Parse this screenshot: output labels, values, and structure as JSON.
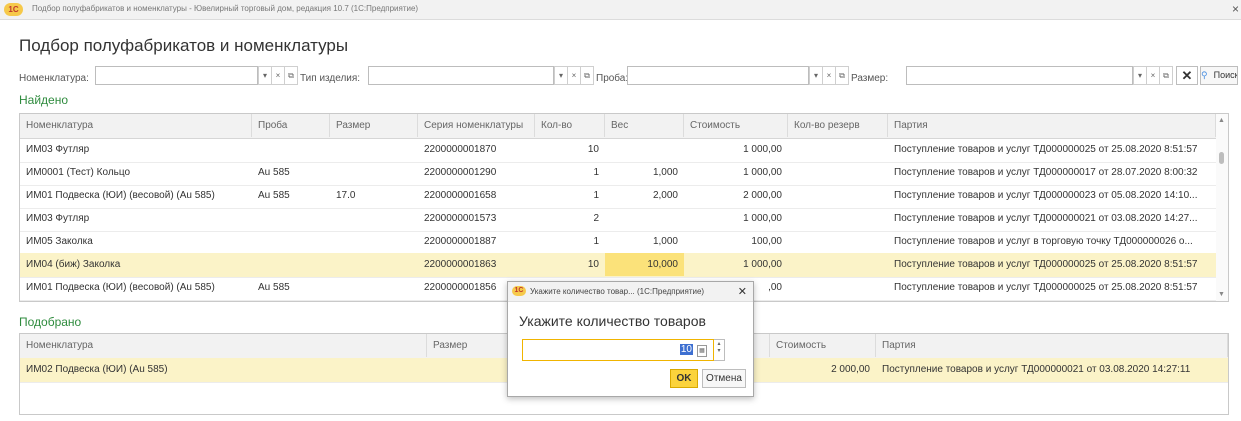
{
  "window": {
    "app_icon_text": "1C",
    "title": "Подбор полуфабрикатов и номенклатуры - Ювелирный торговый дом, редакция 10.7  (1С:Предприятие)",
    "close_glyph": "×"
  },
  "page": {
    "heading": "Подбор полуфабрикатов и номенклатуры"
  },
  "filters": {
    "nomenclature_label": "Номенклатура:",
    "product_type_label": "Тип изделия:",
    "assay_label": "Проба:",
    "size_label": "Размер:",
    "nomenclature_value": "",
    "product_type_value": "",
    "assay_value": "",
    "size_value": "",
    "search_label": "Поиск"
  },
  "found": {
    "title": "Найдено",
    "columns": [
      "Номенклатура",
      "Проба",
      "Размер",
      "Серия номенклатуры",
      "Кол-во",
      "Вес",
      "Стоимость",
      "Кол-во резерв",
      "Партия"
    ],
    "rows": [
      {
        "name": "ИМ03 Футляр",
        "assay": "",
        "size": "",
        "series": "2200000001870",
        "qty": "10",
        "weight": "",
        "cost": "1 000,00",
        "reserve": "",
        "batch": "Поступление товаров и услуг ТД000000025 от 25.08.2020 8:51:57"
      },
      {
        "name": "ИМ0001 (Тест) Кольцо",
        "assay": "Au 585",
        "size": "",
        "series": "2200000001290",
        "qty": "1",
        "weight": "1,000",
        "cost": "1 000,00",
        "reserve": "",
        "batch": "Поступление товаров и услуг ТД000000017 от 28.07.2020 8:00:32"
      },
      {
        "name": "ИМ01 Подвеска (ЮИ) (весовой) (Au 585)",
        "assay": "Au 585",
        "size": "17.0",
        "series": "2200000001658",
        "qty": "1",
        "weight": "2,000",
        "cost": "2 000,00",
        "reserve": "",
        "batch": "Поступление товаров и услуг ТД000000023 от 05.08.2020 14:10..."
      },
      {
        "name": "ИМ03 Футляр",
        "assay": "",
        "size": "",
        "series": "2200000001573",
        "qty": "2",
        "weight": "",
        "cost": "1 000,00",
        "reserve": "",
        "batch": "Поступление товаров и услуг ТД000000021 от 03.08.2020 14:27..."
      },
      {
        "name": "ИМ05 Заколка",
        "assay": "",
        "size": "",
        "series": "2200000001887",
        "qty": "1",
        "weight": "1,000",
        "cost": "100,00",
        "reserve": "",
        "batch": "Поступление товаров и услуг в торговую точку ТД000000026 о..."
      },
      {
        "name": "ИМ04 (биж) Заколка",
        "assay": "",
        "size": "",
        "series": "2200000001863",
        "qty": "10",
        "weight": "10,000",
        "cost": "1 000,00",
        "reserve": "",
        "batch": "Поступление товаров и услуг ТД000000025 от 25.08.2020 8:51:57"
      },
      {
        "name": "ИМ01 Подвеска (ЮИ) (весовой) (Au 585)",
        "assay": "Au 585",
        "size": "",
        "series": "2200000001856",
        "qty": "",
        "weight": "",
        "cost": ",00",
        "reserve": "",
        "batch": "Поступление товаров и услуг ТД000000025 от 25.08.2020 8:51:57"
      }
    ]
  },
  "selected": {
    "title": "Подобрано",
    "columns": [
      "Номенклатура",
      "Размер",
      "Стоимость",
      "Партия"
    ],
    "rows": [
      {
        "name": "ИМ02 Подвеска (ЮИ) (Au 585)",
        "size": "",
        "cost": "2 000,00",
        "batch": "Поступление товаров и услуг ТД000000021 от 03.08.2020 14:27:11"
      }
    ]
  },
  "dialog": {
    "title": "Укажите количество товар... (1С:Предприятие)",
    "heading": "Укажите количество товаров",
    "value": "10",
    "ok_label": "OK",
    "cancel_label": "Отмена"
  },
  "colors": {
    "accent_green": "#2e8b3d",
    "selection_yellow": "#fbf3c8",
    "highlight_yellow": "#fbe27a",
    "ok_button": "#fbd33c"
  }
}
